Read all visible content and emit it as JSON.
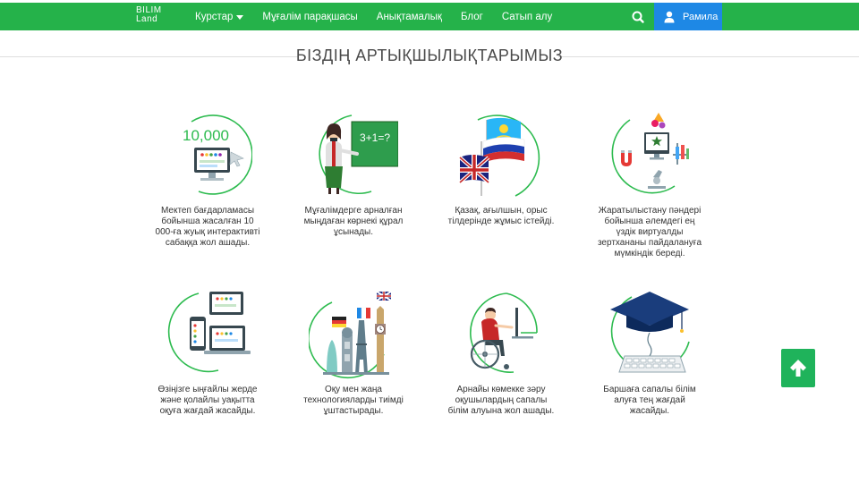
{
  "nav": {
    "logo_top": "BILIM",
    "logo_bottom": "Land",
    "links": [
      {
        "label": "Курстар",
        "dropdown": true
      },
      {
        "label": "Мұғалім парақшасы"
      },
      {
        "label": "Анықтамалық"
      },
      {
        "label": "Блог"
      },
      {
        "label": "Сатып алу"
      }
    ],
    "search_icon": "search-icon",
    "user_name": "Рамила",
    "user_icon": "user-icon"
  },
  "section": {
    "title": "БІЗДІҢ АРТЫҚШЫЛЫҚТАРЫМЫЗ"
  },
  "features": [
    {
      "caption": "Мектеп бағдарламасы бойынша жасалған 10 000-ға жуық интерактивті сабаққа жол ашады.",
      "illustration_text": "10,000",
      "icon": "monitor-icon"
    },
    {
      "caption": "Мұғалімдерге арналған мыңдаған көрнекі құрал ұсынады.",
      "illustration_text": "3+1=?",
      "icon": "teacher-icon"
    },
    {
      "caption": "Қазақ, ағылшын, орыс тілдерінде жұмыс істейді.",
      "icon": "flags-icon"
    },
    {
      "caption": "Жаратылыстану пәндері бойынша әлемдегі ең үздік виртуалды зертхананы пайдалануға мүмкіндік береді.",
      "icon": "lab-icon"
    },
    {
      "caption": "Өзіңізге ыңғайлы жерде және қолайлы уақытта оқуға жағдай жасайды.",
      "icon": "devices-icon"
    },
    {
      "caption": "Оқу мен жаңа технологияларды тиімді ұштастырады.",
      "icon": "landmarks-icon"
    },
    {
      "caption": "Арнайы көмекке зәру оқушылардың сапалы білім алуына жол ашады.",
      "icon": "wheelchair-icon"
    },
    {
      "caption": "Баршаға сапалы білім алуға тең жағдай жасайды.",
      "icon": "graduation-cap-icon"
    }
  ],
  "scroll_top_icon": "arrow-up-icon",
  "colors": {
    "nav_green": "#25b24a",
    "user_blue": "#1e88e5",
    "accent_green": "#2dbb4f",
    "up_button": "#1fb35b"
  }
}
